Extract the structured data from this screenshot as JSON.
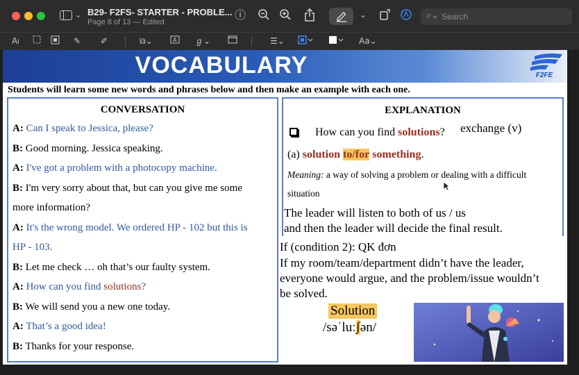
{
  "window": {
    "title": "B29- F2FS- STARTER - PROBLE...",
    "subtitle": "Page 8 of 13 — Edited",
    "search_placeholder": "Search"
  },
  "toolbar2": {
    "text_tool_label": "A",
    "font_label": "Aa"
  },
  "document": {
    "banner_title": "VOCABULARY",
    "logo_text": "F2FE",
    "intro": "Students will learn some new words and phrases below and then make an example with each one.",
    "conversation": {
      "heading": "CONVERSATION",
      "lines": [
        {
          "speaker": "A:",
          "text": "Can I speak to Jessica, please?"
        },
        {
          "speaker": "B:",
          "text": "Good morning. Jessica speaking."
        },
        {
          "speaker": "A:",
          "text": "I've got a problem with a photocopy machine."
        },
        {
          "speaker": "B:",
          "text": "I'm very sorry about that, but can you give me some"
        },
        {
          "speaker": "",
          "text": "more information?"
        },
        {
          "speaker": "A:",
          "text": "It's the wrong model. We ordered HP - 102 but this is"
        },
        {
          "speaker": "",
          "text": "HP - 103."
        },
        {
          "speaker": "B:",
          "text": "Let me check … oh that’s our faulty system."
        },
        {
          "speaker": "A:",
          "text": "How can you find",
          "highlight": "solutions",
          "end": "?"
        },
        {
          "speaker": "B:",
          "text": "We will send you a new one today."
        },
        {
          "speaker": "A:",
          "text": "That’s a good idea!"
        },
        {
          "speaker": "B:",
          "text": "Thanks for your response."
        }
      ]
    },
    "explanation": {
      "heading": "EXPLANATION",
      "question_pre": "How can you find",
      "question_word": "solutions",
      "question_end": "?",
      "note": "exchange (v)",
      "usage_prefix": "(a)",
      "usage_word": "solution",
      "usage_prep": "to/for",
      "usage_obj": "something",
      "usage_end": ".",
      "meaning_label": "Meaning:",
      "meaning_text_1": "a way of solving a problem or dealing with a difficult",
      "meaning_text_2": "situation",
      "example_1": "The leader will listen to both of us / us",
      "example_2": "and then the leader will decide the final result.",
      "cond_line": "If (condition 2): QK đơn",
      "cond_1": "If my room/team/department didn’t have the leader,",
      "cond_2": "everyone would argue, and the problem/issue wouldn’t",
      "cond_3": "be solved.",
      "word": "Solution",
      "phon_pre": "/səˈluː",
      "phon_hl": "ʃ",
      "phon_post": "ən/"
    }
  },
  "colors": {
    "speaker_a_text": "#2f59a3",
    "highlight_word": "#9a2f1f",
    "highlight_bg": "#f6c75f",
    "box_border": "#5b7fc1"
  }
}
